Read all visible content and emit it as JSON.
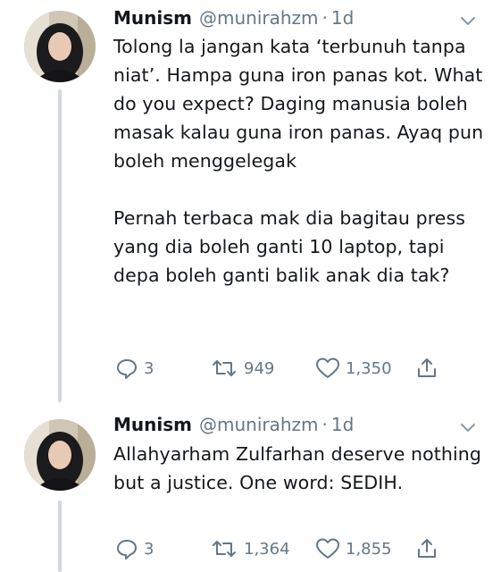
{
  "tweets": [
    {
      "name": "Munism",
      "handle": "@munirahzm",
      "separator": "·",
      "time": "1d",
      "text": "Tolong la jangan kata ‘terbunuh tanpa niat’. Hampa guna iron panas kot. What do you expect? Daging manusia boleh masak kalau guna iron panas. Ayaq pun boleh menggelegak\n\nPernah terbaca mak dia bagitau press yang dia boleh ganti 10 laptop, tapi depa boleh ganti balik anak dia tak?",
      "replies": "3",
      "retweets": "949",
      "likes": "1,350"
    },
    {
      "name": "Munism",
      "handle": "@munirahzm",
      "separator": "·",
      "time": "1d",
      "text": "Allahyarham Zulfarhan deserve nothing but a justice. One word: SEDIH.",
      "replies": "3",
      "retweets": "1,364",
      "likes": "1,855"
    }
  ],
  "colors": {
    "text": "#14171a",
    "secondary": "#657786",
    "thread_line": "#cfd9de"
  },
  "icons": [
    "reply-icon",
    "retweet-icon",
    "like-icon",
    "share-icon",
    "chevron-down-icon"
  ]
}
